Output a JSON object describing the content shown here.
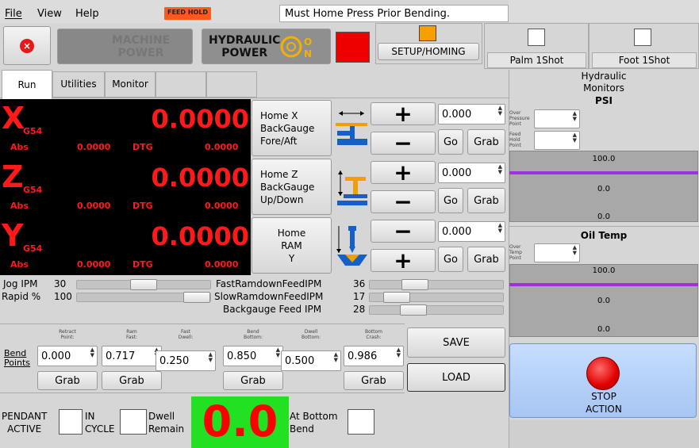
{
  "menu": {
    "file": "File",
    "view": "View",
    "help": "Help"
  },
  "feed_hold": "FEED HOLD",
  "message": "Must Home Press Prior Bending.",
  "machine_power": {
    "line1": "MACHINE",
    "line2": "POWER"
  },
  "hydraulic_power": {
    "line1": "HYDRAULIC",
    "line2": "POWER"
  },
  "setup_homing": "SETUP/HOMING",
  "palm_oneshot": "Palm 1Shot",
  "foot_oneshot": "Foot 1Shot",
  "tabs": [
    "Run",
    "Utilities",
    "Monitor"
  ],
  "axes": [
    {
      "letter": "X",
      "wcs": "G54",
      "value": "0.0000",
      "abs_label": "Abs",
      "abs_value": "0.0000",
      "dtg_label": "DTG",
      "dtg_value": "0.0000",
      "home_label": "Home X\nBackGauge\nFore/Aft",
      "step": "0.000",
      "first_sign": "+",
      "second_sign": "−"
    },
    {
      "letter": "Z",
      "wcs": "G54",
      "value": "0.0000",
      "abs_label": "Abs",
      "abs_value": "0.0000",
      "dtg_label": "DTG",
      "dtg_value": "0.0000",
      "home_label": "Home Z\nBackGauge\nUp/Down",
      "step": "0.000",
      "first_sign": "+",
      "second_sign": "−"
    },
    {
      "letter": "Y",
      "wcs": "G54",
      "value": "0.0000",
      "abs_label": "Abs",
      "abs_value": "0.0000",
      "dtg_label": "DTG",
      "dtg_value": "0.0000",
      "home_label": "Home\nRAM\nY",
      "step": "0.000",
      "first_sign": "−",
      "second_sign": "+"
    }
  ],
  "go_label": "Go",
  "grab_label": "Grab",
  "feeds": {
    "jog_label": "Jog  IPM",
    "jog_value": "30",
    "jog_level": 0.5,
    "rapid_label": "Rapid %",
    "rapid_value": "100",
    "rapid_level": 1.0,
    "fast_label": "FastRamdownFeedIPM",
    "fast_value": "36",
    "fast_level": 0.3,
    "slow_label": "SlowRamdownFeedIPM",
    "slow_value": "17",
    "slow_level": 0.13,
    "backgauge_label": "Backgauge Feed  IPM",
    "backgauge_value": "28",
    "backgauge_level": 0.28
  },
  "bend_points": {
    "label": "Bend\nPoints",
    "fields": [
      {
        "caption": "Retract\nPoint:",
        "value": "0.000",
        "grab": true
      },
      {
        "caption": "Ram\nFast:",
        "value": "0.717",
        "grab": true
      },
      {
        "caption": "Fast\nDwell:",
        "value": "0.250",
        "grab": false
      },
      {
        "caption": "Bend\nBottom:",
        "value": "0.850",
        "grab": true
      },
      {
        "caption": "Dwell\nBottom:",
        "value": "0.500",
        "grab": false
      },
      {
        "caption": "Bottom\nCrash:",
        "value": "0.986",
        "grab": true
      }
    ]
  },
  "save": "SAVE",
  "load": "LOAD",
  "status": {
    "pendant": "PENDANT\nACTIVE",
    "in_cycle": "IN\nCYCLE",
    "dwell": "Dwell\nRemain",
    "dwell_value": "0.0",
    "at_bottom": "At Bottom\nBend"
  },
  "hydraulic_monitors": {
    "title": "Hydraulic\nMonitors",
    "unit": "PSI",
    "over_pressure": "Over\nPressure\nPoint",
    "feed_hold_point": "Feed\nHold\nPoint",
    "bar_values": [
      "100.0",
      "0.0",
      "0.0"
    ]
  },
  "oil_temp": {
    "title": "Oil Temp",
    "over_temp": "Over\nTemp\nPoint",
    "bar_values": [
      "100.0",
      "0.0",
      "0.0"
    ]
  },
  "stop_action": "STOP\nACTION",
  "colors": {
    "dro_red": "#ff1a1a",
    "dwell_green": "#22e022",
    "stop_red": "#e00000",
    "monitor_purple": "#9b30e6",
    "hydraulic_on": "#f2b000",
    "setup_orange": "#f6a000",
    "indicator_red": "#ee0000"
  }
}
